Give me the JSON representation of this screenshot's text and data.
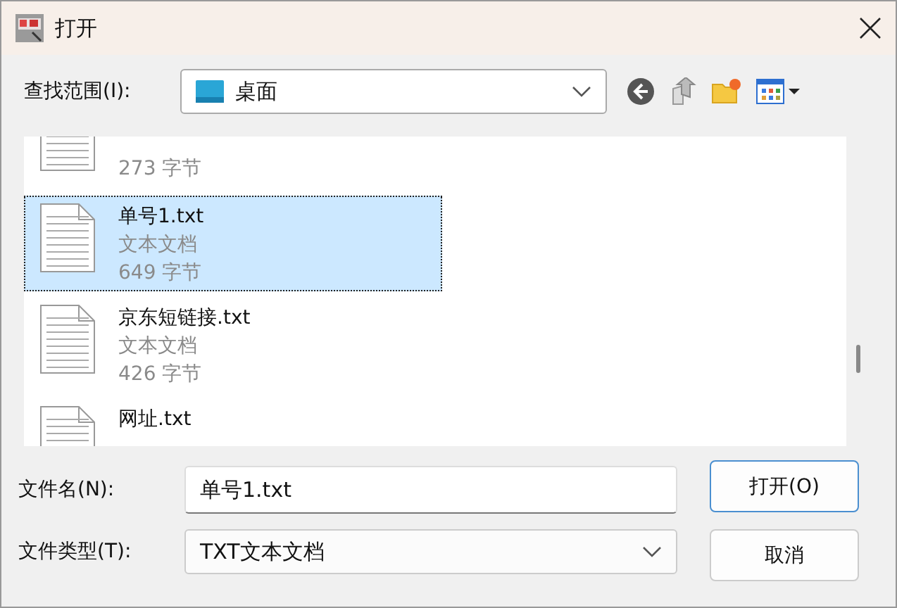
{
  "window": {
    "title": "打开"
  },
  "look_in": {
    "label": "查找范围(I):",
    "value": "桌面"
  },
  "files": [
    {
      "size": "273 字节",
      "selected": false
    },
    {
      "name": "单号1.txt",
      "type": "文本文档",
      "size": "649 字节",
      "selected": true
    },
    {
      "name": "京东短链接.txt",
      "type": "文本文档",
      "size": "426 字节",
      "selected": false
    },
    {
      "name": "网址.txt",
      "selected": false
    }
  ],
  "file_name": {
    "label": "文件名(N):",
    "value": "单号1.txt"
  },
  "file_type": {
    "label": "文件类型(T):",
    "value": "TXT文本文档"
  },
  "buttons": [
    {
      "label": "打开(O)",
      "kind": "default"
    },
    {
      "label": "取消",
      "kind": "normal"
    }
  ]
}
